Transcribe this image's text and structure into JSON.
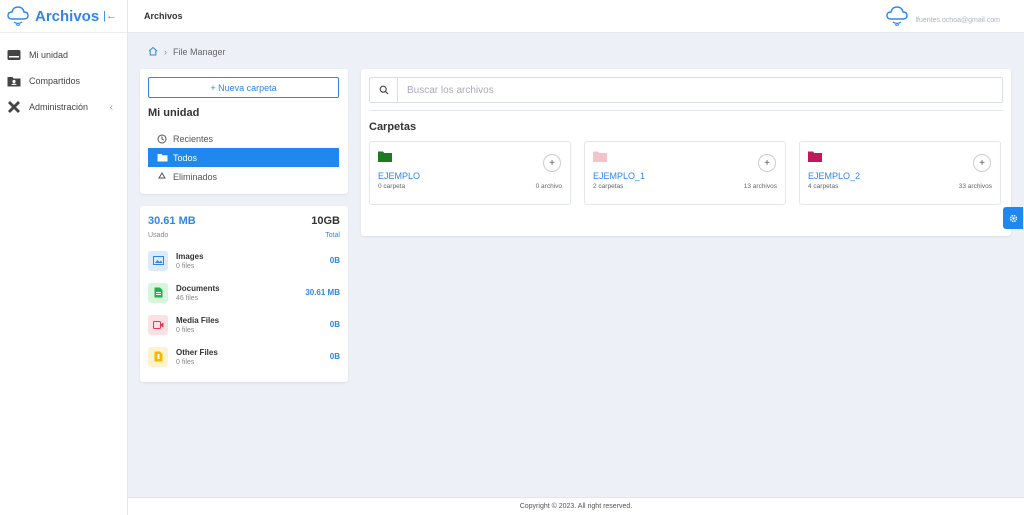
{
  "brand": {
    "name": "Archivos"
  },
  "sidebar": {
    "items": [
      {
        "label": "Mi unidad"
      },
      {
        "label": "Compartidos"
      },
      {
        "label": "Administración"
      }
    ]
  },
  "topbar": {
    "title": "Archivos",
    "email": "lfuentes.ochoa@gmail.com"
  },
  "breadcrumb": {
    "current": "File Manager"
  },
  "nav_card": {
    "new_folder_label": "+ Nueva carpeta",
    "section_title": "Mi unidad",
    "links": [
      {
        "label": "Recientes"
      },
      {
        "label": "Todos"
      },
      {
        "label": "Eliminados"
      }
    ]
  },
  "storage": {
    "used": "30.61 MB",
    "total": "10GB",
    "used_label": "Usado",
    "total_label": "Total",
    "types": [
      {
        "name": "Images",
        "count": "0 files",
        "size": "0B"
      },
      {
        "name": "Documents",
        "count": "46 files",
        "size": "30.61 MB"
      },
      {
        "name": "Media Files",
        "count": "0 files",
        "size": "0B"
      },
      {
        "name": "Other Files",
        "count": "0 files",
        "size": "0B"
      }
    ]
  },
  "search": {
    "placeholder": "Buscar los archivos"
  },
  "folders_section": {
    "title": "Carpetas"
  },
  "folders": [
    {
      "name": "EJEMPLO",
      "subfolders": "0 carpeta",
      "files": "0 archivo",
      "color": "#1e7a1e"
    },
    {
      "name": "EJEMPLO_1",
      "subfolders": "2 carpetas",
      "files": "13 archivos",
      "color": "#f2c4c8"
    },
    {
      "name": "EJEMPLO_2",
      "subfolders": "4 carpetas",
      "files": "33 archivos",
      "color": "#c2185b"
    }
  ],
  "colors": {
    "accent": "#2f86e8",
    "active": "#1e88f0"
  },
  "footer": {
    "text": "Copyright © 2023. All right reserved."
  }
}
